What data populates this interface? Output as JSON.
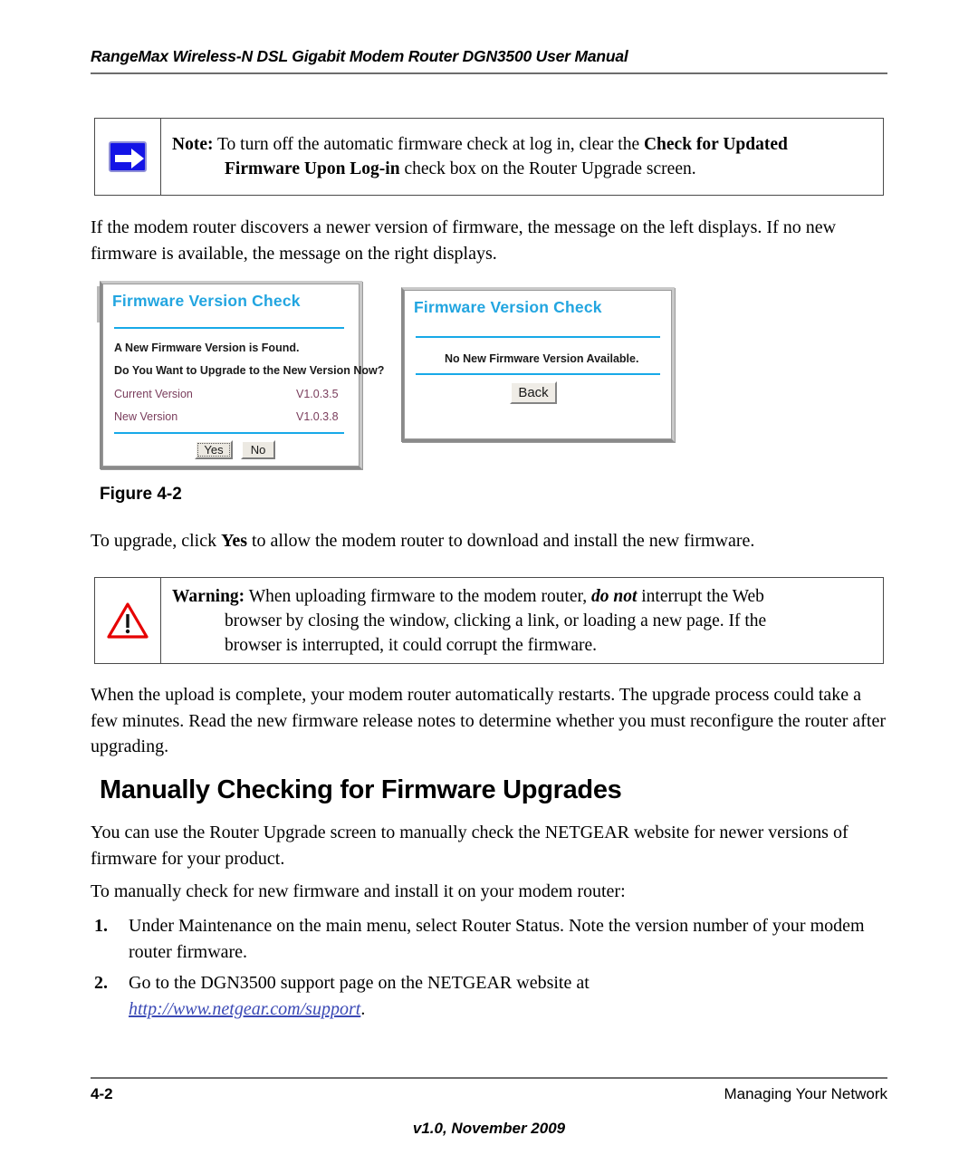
{
  "header": {
    "title": "RangeMax Wireless-N DSL Gigabit Modem Router DGN3500 User Manual"
  },
  "note_box": {
    "icon": "blue-right-arrow-icon",
    "label": "Note:",
    "line1_rest": " To turn off the automatic firmware check at log in, clear the ",
    "line1_bold": "Check for Updated",
    "line2_bold": "Firmware Upon Log-in",
    "line2_rest": " check box on the Router Upgrade screen."
  },
  "intro_paragraph": "If the modem router discovers a newer version of firmware, the message on the left displays. If no new firmware is available, the message on the right displays.",
  "figure": {
    "caption": "Figure 4-2",
    "left_dialog": {
      "title": "Firmware Version Check",
      "message1": "A New Firmware Version is Found.",
      "message2": "Do You Want to Upgrade to the New Version Now?",
      "rows": [
        {
          "label": "Current Version",
          "value": "V1.0.3.5"
        },
        {
          "label": "New Version",
          "value": "V1.0.3.8"
        }
      ],
      "yes_button": "Yes",
      "no_button": "No"
    },
    "right_dialog": {
      "title": "Firmware Version Check",
      "message": "No New Firmware Version Available.",
      "back_button": "Back"
    }
  },
  "upgrade_line": {
    "before": "To upgrade, click ",
    "bold": "Yes",
    "after": " to allow the modem router to download and install the new firmware."
  },
  "warning_box": {
    "icon": "red-warning-triangle-icon",
    "label": "Warning:",
    "line1_rest": " When uploading firmware to the modem router, ",
    "line1_italic": "do not",
    "line1_tail": " interrupt the Web",
    "line2": "browser by closing the window, clicking a link, or loading a new page. If the",
    "line3": "browser is interrupted, it could corrupt the firmware."
  },
  "restart_paragraph": "When the upload is complete, your modem router automatically restarts. The upgrade process could take a few minutes. Read the new firmware release notes to determine whether you must reconfigure the router after upgrading.",
  "section_heading": "Manually Checking for Firmware Upgrades",
  "section_paragraph_1": "You can use the Router Upgrade screen to manually check the NETGEAR website for newer versions of firmware for your product.",
  "section_paragraph_2": "To manually check for new firmware and install it on your modem router:",
  "steps": [
    {
      "number": "1.",
      "text": "Under Maintenance on the main menu, select Router Status. Note the version number of your modem router firmware."
    },
    {
      "number": "2.",
      "text": "Go to the DGN3500 support page on the NETGEAR website at ",
      "url": "http://www.netgear.com/support",
      "trailing": "."
    }
  ],
  "footer": {
    "page_number": "4-2",
    "section": "Managing Your Network",
    "version": "v1.0, November 2009"
  },
  "colors": {
    "dialog_title": "#22a5e0",
    "dialog_rule": "#17a9e8",
    "dialog_label": "#7a3d5c",
    "note_icon": "#1414e6",
    "warning_icon": "#e60000",
    "link": "#3a49b5",
    "rule": "#6d6d6d"
  }
}
